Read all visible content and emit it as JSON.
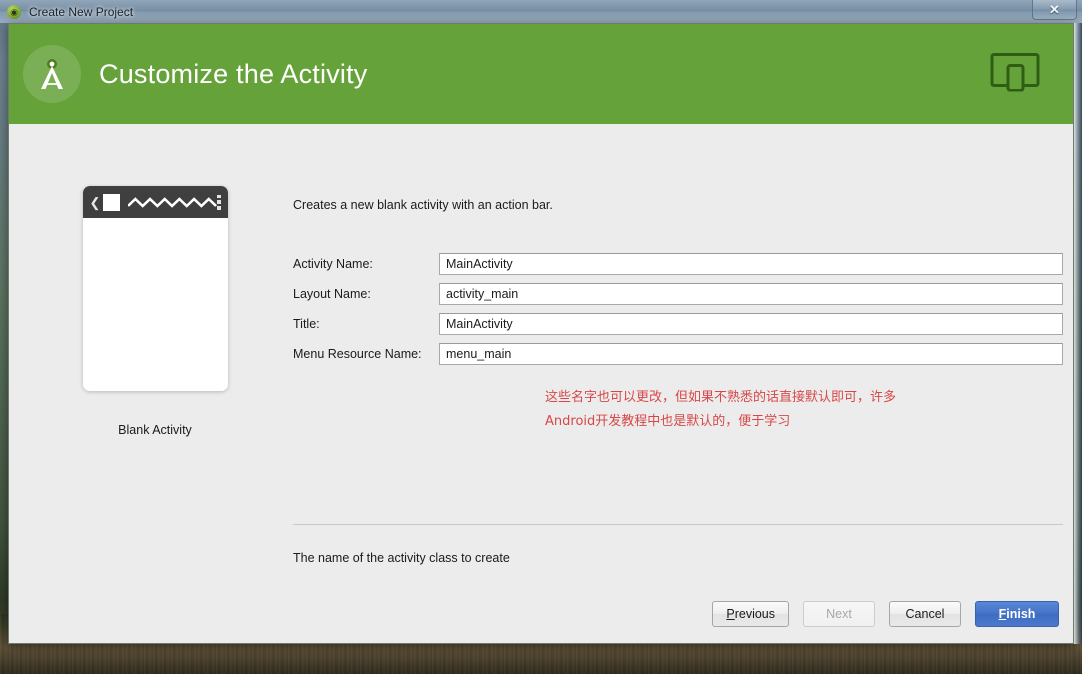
{
  "window": {
    "title": "Create New Project",
    "app_icon": "android-studio-icon",
    "close_label": "✕"
  },
  "header": {
    "title": "Customize the Activity",
    "logo_icon": "android-studio-compass-icon",
    "device_icon": "tablet-and-phone-icon",
    "bg_color": "#65a23a"
  },
  "preview": {
    "caption": "Blank Activity",
    "actionbar": {
      "back_icon": "chevron-left-icon",
      "app_icon": "app-square-icon",
      "title_placeholder_icon": "zigzag-title-icon",
      "overflow_icon": "overflow-menu-icon"
    }
  },
  "main": {
    "description": "Creates a new blank activity with an action bar.",
    "fields": [
      {
        "label": "Activity Name:",
        "value": "MainActivity"
      },
      {
        "label": "Layout Name:",
        "value": "activity_main"
      },
      {
        "label": "Title:",
        "value": "MainActivity"
      },
      {
        "label": "Menu Resource Name:",
        "value": "menu_main"
      }
    ],
    "help_text": "The name of the activity class to create"
  },
  "annotation": {
    "text": "这些名字也可以更改，但如果不熟悉的话直接默认即可，许多Android开发教程中也是默认的，便于学习",
    "color": "#d63a3a"
  },
  "buttons": {
    "previous": {
      "label": "Previous",
      "mnemonic": "P",
      "enabled": true
    },
    "next": {
      "label": "Next",
      "enabled": false
    },
    "cancel": {
      "label": "Cancel",
      "enabled": true
    },
    "finish": {
      "label": "Finish",
      "mnemonic": "F",
      "enabled": true,
      "primary": true,
      "color": "#4372c6"
    }
  }
}
